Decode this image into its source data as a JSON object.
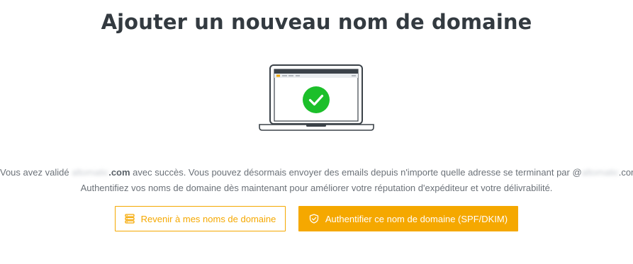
{
  "page": {
    "title": "Ajouter un nouveau nom de domaine"
  },
  "message": {
    "line1_prefix": "Vous avez validé ",
    "line1_domain_blurred": "altomatic",
    "line1_domain_suffix": ".com",
    "line1_middle": " avec succès. Vous pouvez désormais envoyer des emails depuis n'importe quelle adresse se terminant par @",
    "line1_end_blurred": "altomatic",
    "line1_end_suffix": ".com.",
    "line2": "Authentifiez vos noms de domaine dès maintenant pour améliorer votre réputation d'expéditeur et votre délivrabilité."
  },
  "buttons": {
    "back_label": "Revenir à mes noms de domaine",
    "authenticate_label": "Authentifier ce nom de domaine (SPF/DKIM)"
  },
  "colors": {
    "accent": "#f5a800",
    "success": "#1cbf2a",
    "title": "#333a40",
    "text": "#6b7178"
  },
  "icons": {
    "illustration": "laptop-with-checkmark",
    "back_button_icon": "domain-list-icon",
    "authenticate_button_icon": "shield-check-icon"
  }
}
